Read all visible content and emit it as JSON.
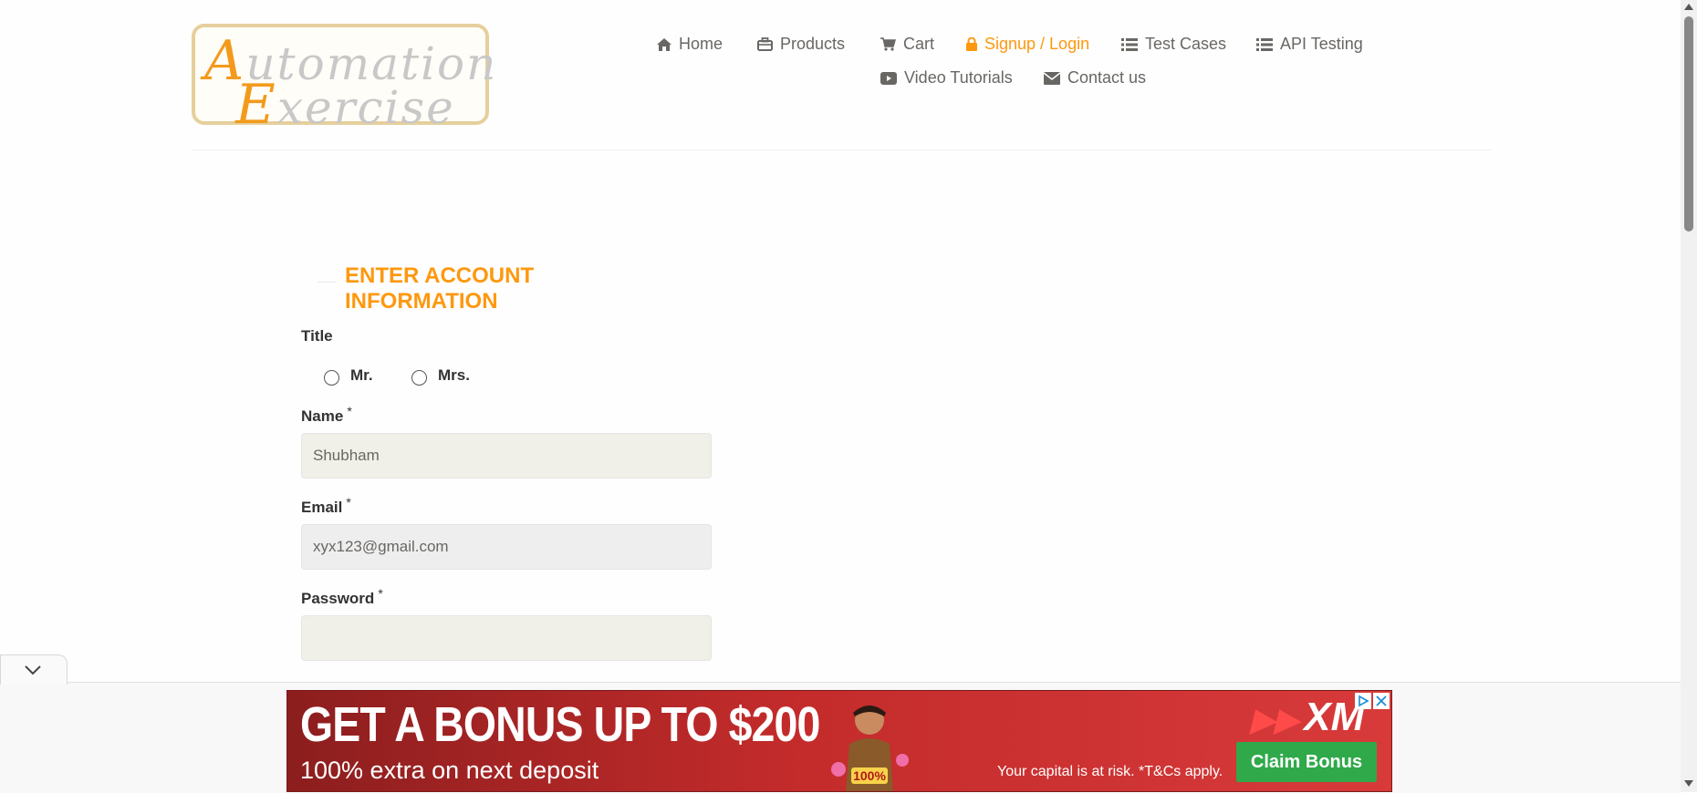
{
  "logo": {
    "line1_cap": "A",
    "line1_rest": "utomation",
    "line2_cap": "E",
    "line2_rest": "xercise"
  },
  "nav": {
    "home": "Home",
    "products": "Products",
    "cart": "Cart",
    "signup_login": "Signup / Login",
    "test_cases": "Test Cases",
    "api_testing": "API Testing",
    "video_tutorials": "Video Tutorials",
    "contact_us": "Contact us"
  },
  "colors": {
    "accent": "#FE980F",
    "input_bg": "#F0F0E9",
    "ad_button": "#2FA94A"
  },
  "form": {
    "heading": "ENTER ACCOUNT INFORMATION",
    "title_label": "Title",
    "title_options": [
      "Mr.",
      "Mrs."
    ],
    "name_label": "Name",
    "name_value": "Shubham",
    "email_label": "Email",
    "email_value": "xyx123@gmail.com",
    "password_label": "Password",
    "password_value": "",
    "required_marker": "*"
  },
  "ad": {
    "headline": "GET A BONUS UP TO $200",
    "subline": "100% extra on next deposit",
    "badge": "100%",
    "risk": "Your capital is at risk. *T&Cs apply.",
    "brand": "XM",
    "button": "Claim Bonus"
  }
}
